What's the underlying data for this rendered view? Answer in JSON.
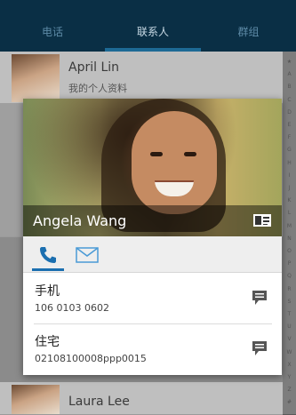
{
  "tabs": [
    {
      "label": "电话"
    },
    {
      "label": "联系人"
    },
    {
      "label": "群组"
    }
  ],
  "background_list": [
    {
      "name": "April Lin",
      "subtitle": "我的个人资料"
    },
    {
      "name": "Laura Lee",
      "subtitle": ""
    }
  ],
  "alphabet": [
    "★",
    "A",
    "B",
    "C",
    "D",
    "E",
    "F",
    "G",
    "H",
    "I",
    "J",
    "K",
    "L",
    "M",
    "N",
    "O",
    "P",
    "Q",
    "R",
    "S",
    "T",
    "U",
    "V",
    "W",
    "X",
    "Y",
    "Z",
    "#"
  ],
  "card": {
    "name": "Angela Wang",
    "entries": [
      {
        "label": "手机",
        "value": "106 0103 0602"
      },
      {
        "label": "住宅",
        "value": "02108100008ppp0015"
      }
    ]
  },
  "colors": {
    "tabbar": "#0a2f45",
    "accent": "#1b6fb0"
  }
}
